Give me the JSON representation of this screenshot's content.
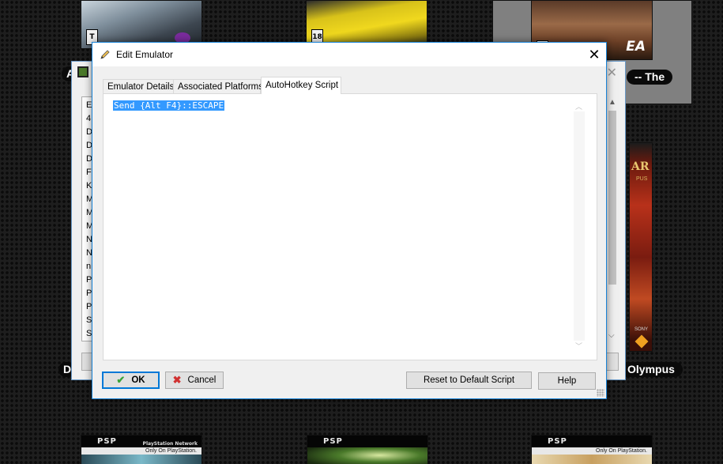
{
  "background": {
    "covers_top": [
      {
        "rating": "T"
      },
      {
        "rating": "18"
      },
      {
        "rating": "E",
        "publisher": "EA"
      }
    ],
    "god_of_war_cover": {
      "title_fragment": "AR",
      "subtitle_fragment": "PUS",
      "brand": "SONY"
    },
    "title_pills": {
      "the": "-- The",
      "olympus": "Olympus",
      "left_fragment_1": "A",
      "left_fragment_2": "D"
    },
    "covers_bottom": [
      {
        "band": "PSP",
        "network": "PlayStation Network",
        "only_on": "Only On PlayStation."
      },
      {
        "band": "PSP",
        "network": "",
        "only_on": ""
      },
      {
        "band": "PSP",
        "network": "",
        "only_on": "Only On PlayStation."
      }
    ]
  },
  "parent_window": {
    "list_letters": [
      "E",
      "4",
      "D",
      "D",
      "D",
      "F",
      "K",
      "M",
      "M",
      "M",
      "N",
      "N",
      "n",
      "P",
      "P",
      "P",
      "S",
      "S"
    ]
  },
  "dialog": {
    "title": "Edit Emulator",
    "close_glyph": "✕",
    "tabs": [
      {
        "label": "Emulator Details",
        "active": false
      },
      {
        "label": "Associated Platforms",
        "active": false
      },
      {
        "label": "AutoHotkey Script",
        "active": true
      }
    ],
    "script_text": "Send {Alt F4}::ESCAPE",
    "buttons": {
      "ok": "OK",
      "cancel": "Cancel",
      "reset": "Reset to Default Script",
      "help": "Help"
    }
  },
  "colors": {
    "selection": "#3399ff",
    "dialog_border": "#1883d7",
    "ok_border": "#0078d7",
    "ok_icon": "#3aa33a",
    "cancel_icon": "#d03030"
  },
  "icons": {
    "title": "pencil-icon",
    "ok": "checkmark-icon",
    "cancel": "x-icon"
  }
}
